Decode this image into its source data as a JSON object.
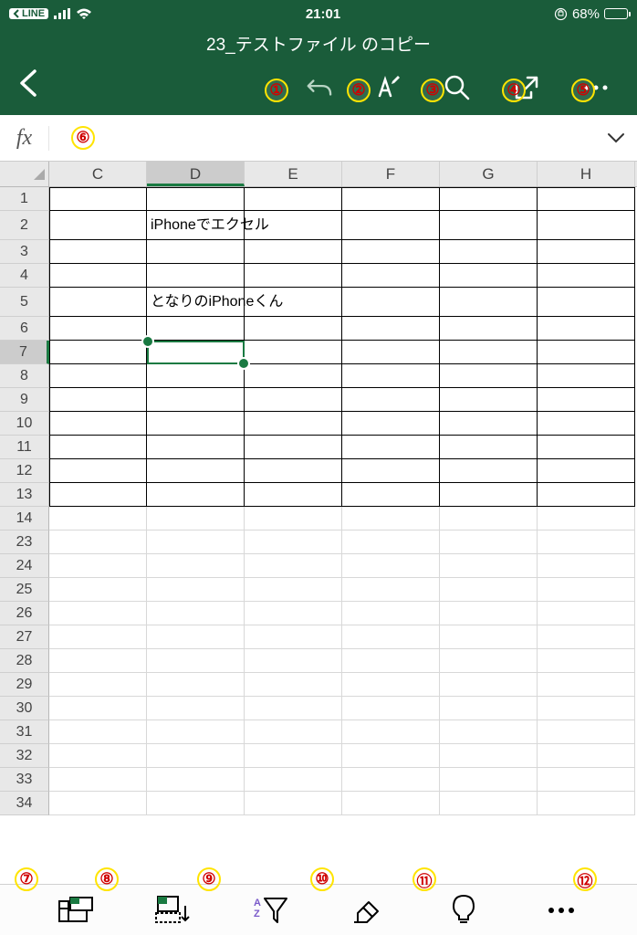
{
  "status": {
    "app_badge": "LINE",
    "time": "21:01",
    "battery_pct": "68%",
    "battery_fill": "68%"
  },
  "header": {
    "title": "23_テストファイル のコピー"
  },
  "formula": {
    "fx": "fx",
    "value": ""
  },
  "columns": [
    "C",
    "D",
    "E",
    "F",
    "G",
    "H"
  ],
  "active_col": "D",
  "active_row": "7",
  "rows_top": [
    "1",
    "2",
    "3",
    "4",
    "5",
    "6",
    "7",
    "8",
    "9",
    "10",
    "11",
    "12",
    "13",
    "14"
  ],
  "rows_bottom": [
    "23",
    "24",
    "25",
    "26",
    "27",
    "28",
    "29",
    "30",
    "31",
    "32",
    "33",
    "34"
  ],
  "cells": {
    "D2": "iPhoneでエクセル",
    "D5": "となりのiPhoneくん"
  },
  "annotations": {
    "1": "①",
    "2": "②",
    "3": "③",
    "4": "④",
    "5": "⑤",
    "6": "⑥",
    "7": "⑦",
    "8": "⑧",
    "9": "⑨",
    "10": "⑩",
    "11": "⑪",
    "12": "⑫"
  }
}
